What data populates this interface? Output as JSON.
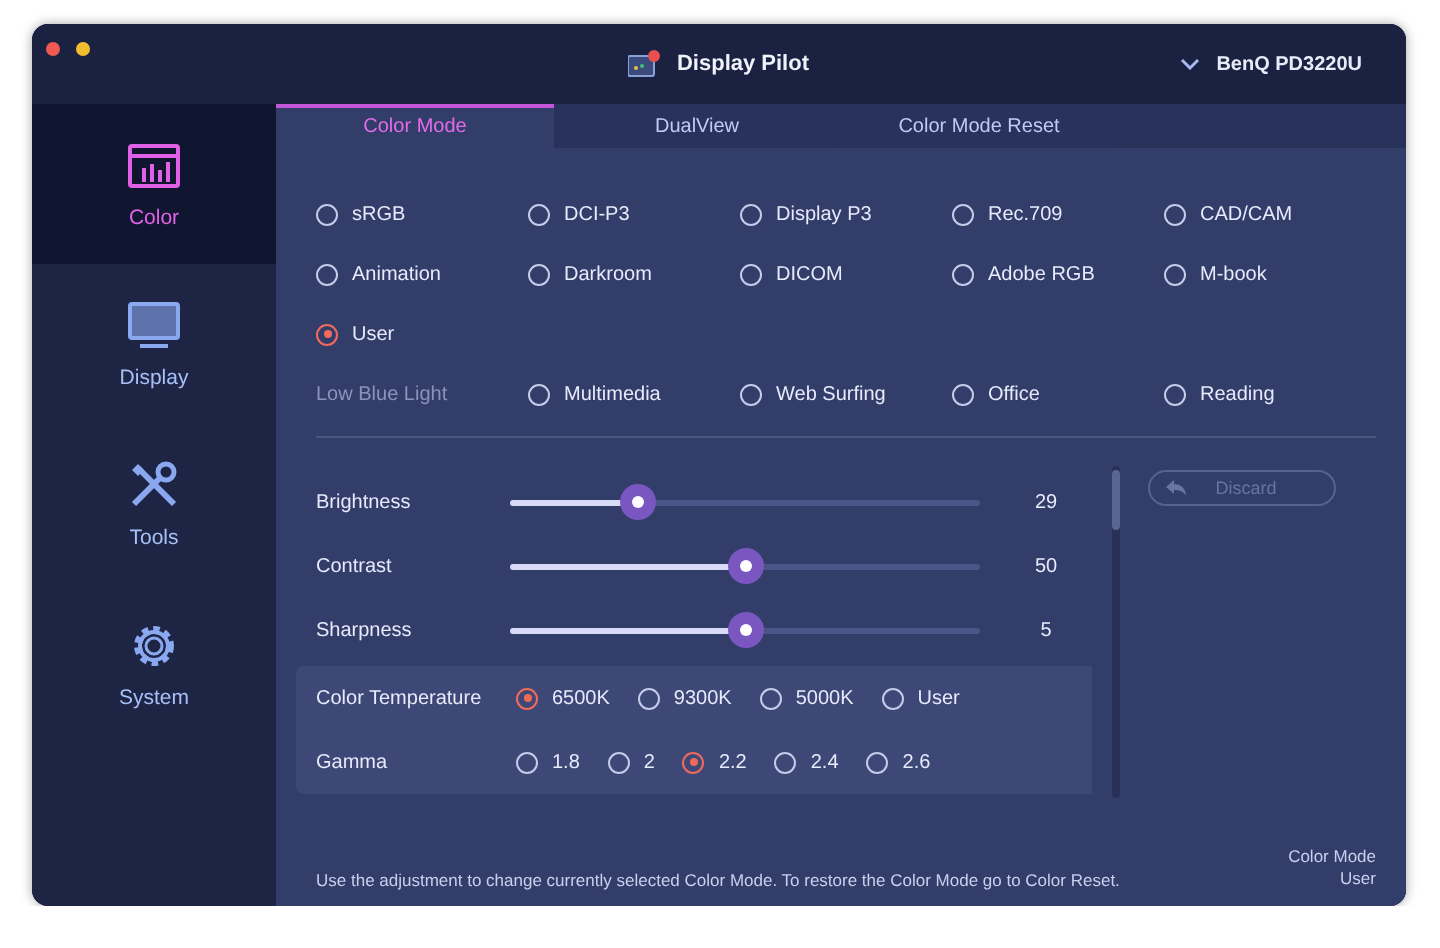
{
  "window": {
    "title": "Display Pilot",
    "device": "BenQ PD3220U"
  },
  "sidebar": {
    "items": [
      {
        "label": "Color",
        "kind": "color",
        "selected": true
      },
      {
        "label": "Display",
        "kind": "display",
        "selected": false
      },
      {
        "label": "Tools",
        "kind": "tools",
        "selected": false
      },
      {
        "label": "System",
        "kind": "system",
        "selected": false
      }
    ]
  },
  "tabs": [
    {
      "label": "Color Mode",
      "selected": true
    },
    {
      "label": "DualView",
      "selected": false
    },
    {
      "label": "Color Mode Reset",
      "selected": false
    }
  ],
  "color_modes": [
    {
      "label": "sRGB",
      "selected": false
    },
    {
      "label": "DCI-P3",
      "selected": false
    },
    {
      "label": "Display P3",
      "selected": false
    },
    {
      "label": "Rec.709",
      "selected": false
    },
    {
      "label": "CAD/CAM",
      "selected": false
    },
    {
      "label": "Animation",
      "selected": false
    },
    {
      "label": "Darkroom",
      "selected": false
    },
    {
      "label": "DICOM",
      "selected": false
    },
    {
      "label": "Adobe RGB",
      "selected": false
    },
    {
      "label": "M-book",
      "selected": false
    },
    {
      "label": "User",
      "selected": true
    }
  ],
  "low_blue_light": {
    "label": "Low Blue Light",
    "options": [
      {
        "label": "Multimedia",
        "selected": false
      },
      {
        "label": "Web Surfing",
        "selected": false
      },
      {
        "label": "Office",
        "selected": false
      },
      {
        "label": "Reading",
        "selected": false
      }
    ]
  },
  "sliders": [
    {
      "label": "Brightness",
      "level": 0.29,
      "reading": "29"
    },
    {
      "label": "Contrast",
      "level": 0.5,
      "reading": "50"
    },
    {
      "label": "Sharpness",
      "level": 0.5,
      "reading": "5"
    }
  ],
  "color_temperature": {
    "label": "Color Temperature",
    "options": [
      {
        "label": "6500K",
        "selected": true
      },
      {
        "label": "9300K",
        "selected": false
      },
      {
        "label": "5000K",
        "selected": false
      },
      {
        "label": "User",
        "selected": false
      }
    ]
  },
  "gamma": {
    "label": "Gamma",
    "options": [
      {
        "label": "1.8",
        "selected": false
      },
      {
        "label": "2",
        "selected": false
      },
      {
        "label": "2.2",
        "selected": true
      },
      {
        "label": "2.4",
        "selected": false
      },
      {
        "label": "2.6",
        "selected": false
      }
    ]
  },
  "discard_button": {
    "label": "Discard",
    "disabled": true
  },
  "footer": {
    "hint": "Use the adjustment to change currently selected Color Mode. To restore the Color Mode go to Color Reset.",
    "status_label": "Color Mode",
    "status_value": "User"
  }
}
